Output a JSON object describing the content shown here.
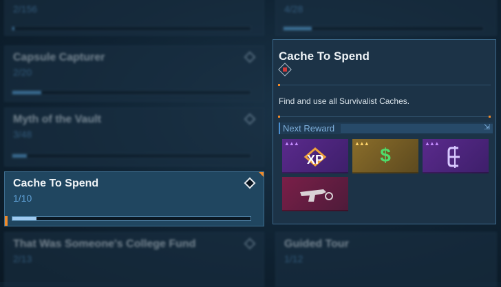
{
  "cards": {
    "top_left": {
      "progress": "2/156",
      "fill": 0.01
    },
    "top_right": {
      "progress": "4/28",
      "fill": 0.14
    },
    "capsule": {
      "title": "Capsule Capturer",
      "progress": "2/20",
      "fill": 0.12
    },
    "myth": {
      "title": "Myth of the Vault",
      "progress": "3/48",
      "fill": 0.06
    },
    "cache": {
      "title": "Cache To Spend",
      "progress": "1/10",
      "fill": 0.1
    },
    "college": {
      "title": "That Was Someone's College Fund",
      "progress": "2/13"
    },
    "guided": {
      "title": "Guided Tour",
      "progress": "1/12"
    }
  },
  "tooltip": {
    "title": "Cache To Spend",
    "description": "Find and use all Survivalist Caches.",
    "next_reward_label": "Next Reward",
    "collapse_glyph": "⇲",
    "rewards": [
      {
        "label": "XP",
        "color": "#5a2a8c",
        "tier": "▲▲▲"
      },
      {
        "label": "$",
        "color": "#8a6d2a",
        "tier": "▲▲▲"
      },
      {
        "label": "Eridium",
        "color": "#5a2a8c",
        "tier": "▲▲▲"
      },
      {
        "label": "weapon-trinket",
        "color": "#7a1f48",
        "tier": ""
      }
    ]
  },
  "colors": {
    "accent_orange": "#f08a2a",
    "accent_blue": "#5aa5dc"
  }
}
